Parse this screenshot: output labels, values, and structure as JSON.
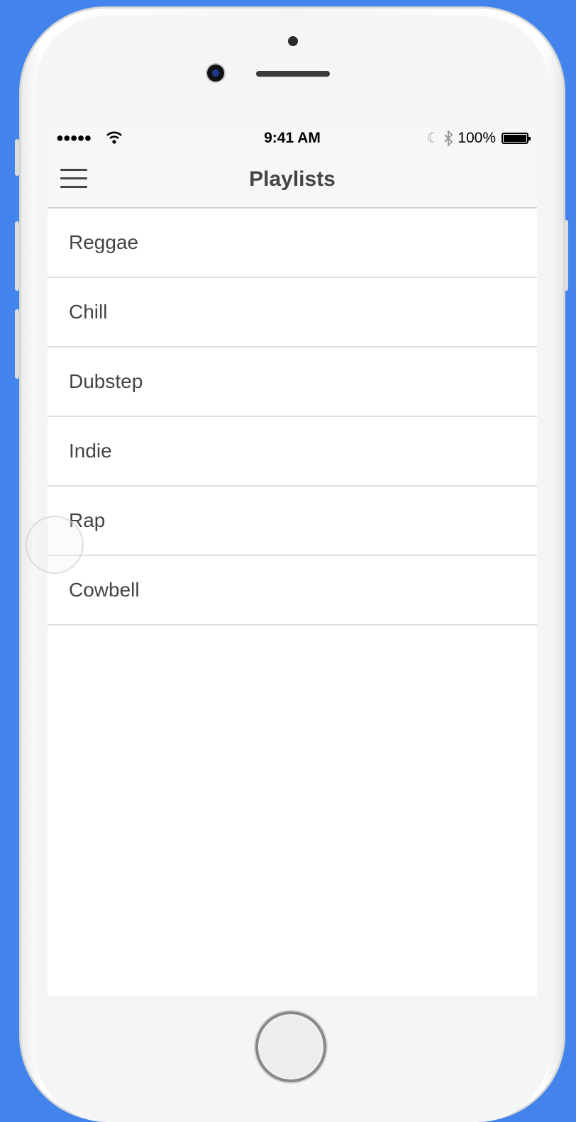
{
  "status_bar": {
    "signal": "●●●●●",
    "time": "9:41 AM",
    "battery_percent": "100%",
    "battery_level": 1.0
  },
  "navbar": {
    "title": "Playlists",
    "menu_icon": "hamburger-menu-icon"
  },
  "playlists": [
    {
      "label": "Reggae"
    },
    {
      "label": "Chill"
    },
    {
      "label": "Dubstep"
    },
    {
      "label": "Indie"
    },
    {
      "label": "Rap"
    },
    {
      "label": "Cowbell"
    }
  ],
  "colors": {
    "background": "#4284ec",
    "text": "#444444",
    "divider": "#dedede"
  }
}
